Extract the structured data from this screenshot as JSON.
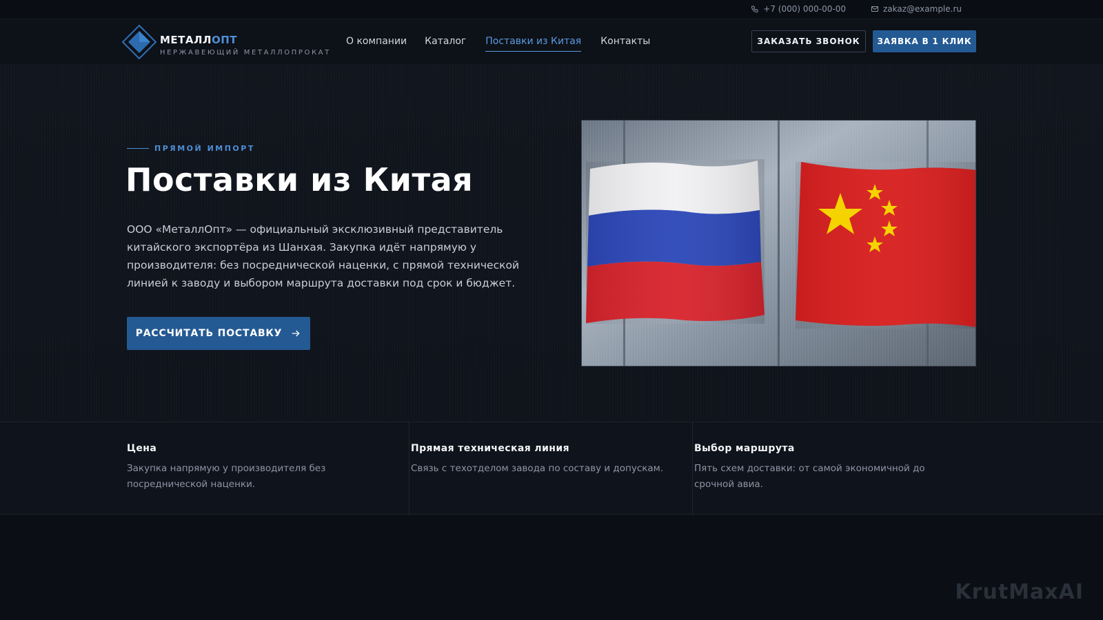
{
  "topbar": {
    "phone": "+7 (000) 000-00-00",
    "email": "zakaz@example.ru"
  },
  "header": {
    "logo_name_main": "МЕТАЛЛ",
    "logo_name_accent": "ОПТ",
    "logo_sub": "НЕРЖАВЕЮЩИЙ МЕТАЛЛОПРОКАТ",
    "nav": [
      "О компании",
      "Каталог",
      "Поставки из Китая",
      "Контакты"
    ],
    "active_nav": "Поставки из Китая",
    "call_button": "ЗАКАЗАТЬ ЗВОНОК",
    "quick_button": "ЗАЯВКА В 1 КЛИК"
  },
  "hero": {
    "eyebrow": "ПРЯМОЙ ИМПОРТ",
    "title": "Поставки из Китая",
    "text": "ООО «МеталлОпт» — официальный эксклюзивный представитель китайского экспортёра из Шанхая. Закупка идёт напрямую у производителя: без посреднической наценки, с прямой технической линией к заводу и выбором маршрута доставки под срок и бюджет.",
    "cta": "РАССЧИТАТЬ ПОСТАВКУ"
  },
  "features": [
    {
      "title": "Цена",
      "text": "Закупка напрямую у производителя без посреднической наценки."
    },
    {
      "title": "Прямая техническая линия",
      "text": "Связь с техотделом завода по составу и допускам."
    },
    {
      "title": "Выбор маршрута",
      "text": "Пять схем доставки: от самой экономичной до срочной авиа."
    }
  ],
  "watermark": "KrutMaxAI",
  "colors": {
    "accent": "#4f8fd6",
    "button": "#245a93",
    "background": "#0b0e14"
  }
}
